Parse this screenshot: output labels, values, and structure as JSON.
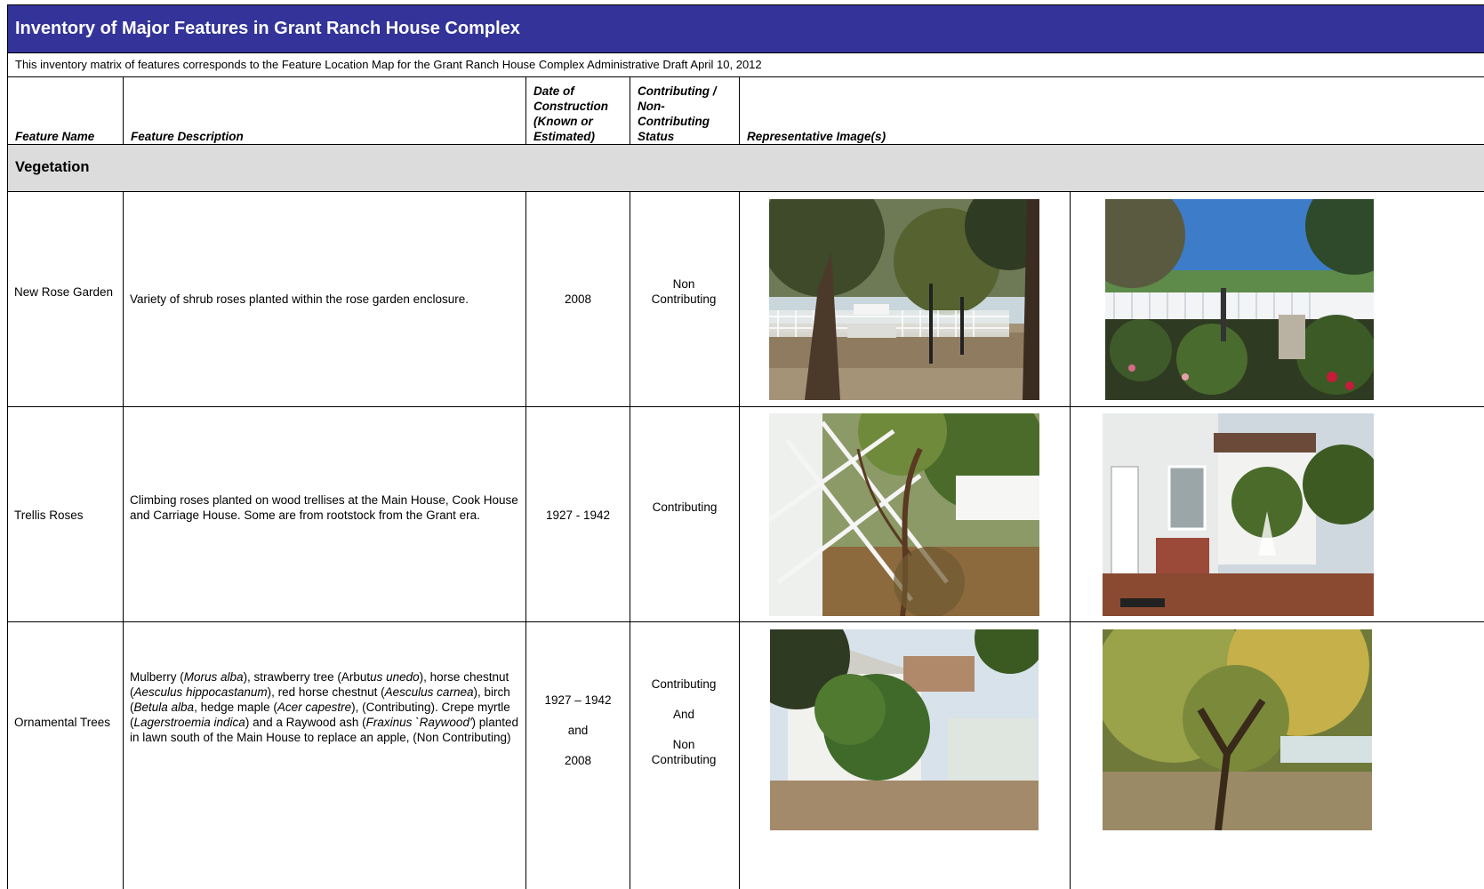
{
  "document": {
    "title": "Inventory of Major Features in Grant Ranch House Complex",
    "subtitle": "This inventory matrix of features corresponds to the Feature Location Map for the Grant Ranch House Complex Administrative Draft April 10, 2012"
  },
  "columns": {
    "name": "Feature Name",
    "description": "Feature Description",
    "date": "Date of Construction (Known or Estimated)",
    "status": "Contributing / Non-Contributing Status",
    "images": "Representative Image(s)"
  },
  "section": {
    "label": "Vegetation"
  },
  "rows": [
    {
      "name": "New Rose Garden",
      "description": "Variety of shrub roses planted within the rose garden enclosure.",
      "date": "2008",
      "status": "Non Contributing"
    },
    {
      "name": "Trellis Roses",
      "description": "Climbing roses planted on wood trellises at the Main House, Cook House and Carriage House. Some are from rootstock from the Grant era.",
      "date": "1927 - 1942",
      "status": "Contributing"
    },
    {
      "name": "Ornamental Trees",
      "description_parts": [
        {
          "t": "Mulberry (",
          "i": false
        },
        {
          "t": "Morus alba",
          "i": true
        },
        {
          "t": "), strawberry tree (Arbut",
          "i": false
        },
        {
          "t": "us unedo",
          "i": true
        },
        {
          "t": "), horse chestnut (",
          "i": false
        },
        {
          "t": "Aesculus hippocastanum",
          "i": true
        },
        {
          "t": "), red horse chestnut (",
          "i": false
        },
        {
          "t": "Aesculus carnea",
          "i": true
        },
        {
          "t": "), birch (",
          "i": false
        },
        {
          "t": "Betula alba",
          "i": true
        },
        {
          "t": ", hedge maple (",
          "i": false
        },
        {
          "t": "Acer capestre",
          "i": true
        },
        {
          "t": "),  (Contributing).  Crepe myrtle (",
          "i": false
        },
        {
          "t": "Lagerstroemia indica",
          "i": true
        },
        {
          "t": ") and a Raywood ash (",
          "i": false
        },
        {
          "t": "Fraxinus `Raywood'",
          "i": true
        },
        {
          "t": ") planted in lawn south of the Main House to replace an apple, (Non Contributing)",
          "i": false
        }
      ],
      "date_lines": [
        "1927 – 1942",
        "and",
        "2008"
      ],
      "status_lines": [
        "Contributing",
        "And",
        "Non Contributing"
      ]
    }
  ]
}
